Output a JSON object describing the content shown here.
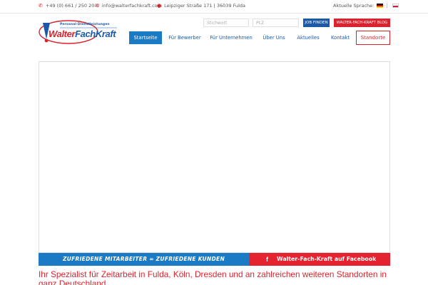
{
  "topbar": {
    "phone": "+49 (0) 661 / 250 20-0",
    "email": "info@walterfachkraft.com",
    "address": "Leipziger Straße 171 | 36039 Fulda",
    "language_label": "Aktuelle Sprache:",
    "icons": {
      "phone": "phone-icon",
      "email": "envelope-icon",
      "address": "map-marker-icon"
    }
  },
  "logo": {
    "subtitle": "Personal-Dienstleistungen",
    "name_part1": "Walter",
    "name_part2": "FachKraft"
  },
  "search": {
    "keyword_placeholder": "Stichwort",
    "zip_placeholder": "PLZ",
    "job_button": "JOB FINDEN",
    "blog_button": "WALTER-FACH-KRAFT BLOG"
  },
  "nav": {
    "items": [
      {
        "label": "Startseite",
        "active": true
      },
      {
        "label": "Für Bewerber"
      },
      {
        "label": "Für Unternehmen"
      },
      {
        "label": "Über Uns"
      },
      {
        "label": "Aktuelles"
      },
      {
        "label": "Kontakt"
      }
    ],
    "standorte": "Standorte"
  },
  "banner": {
    "left_text": "ZUFRIEDENE MITARBEITER = ZUFRIEDENE KUNDEN",
    "right_text": "Walter-Fach-Kraft auf Facebook",
    "right_icon": "facebook-icon"
  },
  "headline": "Ihr Spezialist für Zeitarbeit in Fulda, Köln, Dresden und an zahlreichen weiteren Standorten in ganz Deutschland",
  "colors": {
    "brand_blue": "#1a5aa8",
    "nav_active": "#1a7ac4",
    "brand_red": "#d9232e"
  }
}
